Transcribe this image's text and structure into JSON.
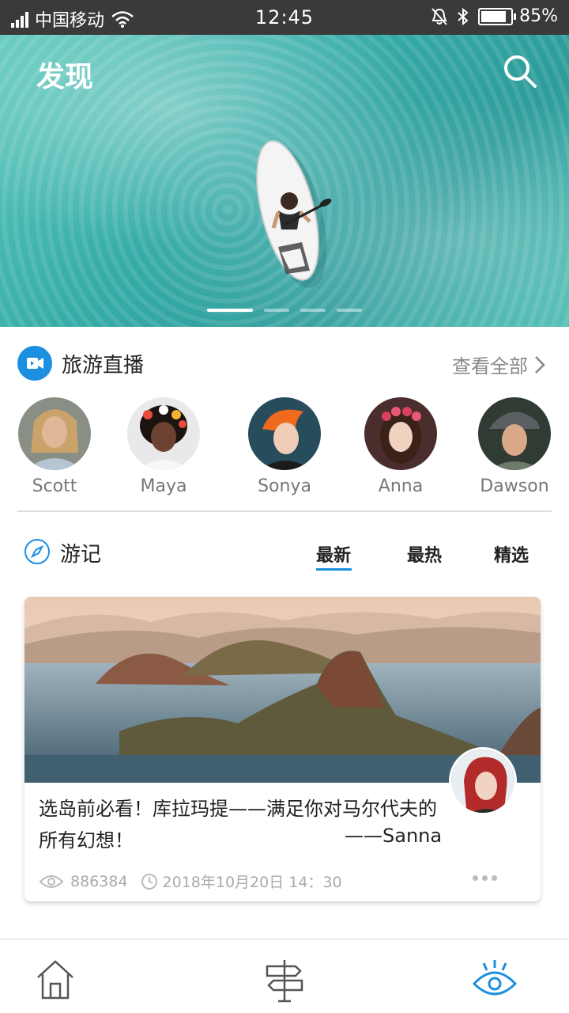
{
  "status": {
    "carrier": "中国移动",
    "time": "12:45",
    "battery_percent": "85%",
    "battery_level": 0.85
  },
  "hero": {
    "title": "发现",
    "slide_count": 4,
    "active_slide": 1
  },
  "live": {
    "title": "旅游直播",
    "view_all": "查看全部",
    "streamers": [
      {
        "name": "Scott"
      },
      {
        "name": "Maya"
      },
      {
        "name": "Sonya"
      },
      {
        "name": "Anna"
      },
      {
        "name": "Dawson"
      }
    ]
  },
  "travelogue": {
    "title": "游记",
    "tabs": [
      {
        "label": "最新",
        "active": true
      },
      {
        "label": "最热",
        "active": false
      },
      {
        "label": "精选",
        "active": false
      }
    ],
    "card": {
      "text": "选岛前必看！库拉玛提——满足你对马尔代夫的所有幻想！",
      "author": "——Sanna",
      "views": "886384",
      "date": "2018年10月20日 14：30"
    }
  },
  "nav": {
    "items": [
      {
        "icon": "home-icon",
        "active": false
      },
      {
        "icon": "signpost-icon",
        "active": false
      },
      {
        "icon": "eye-icon",
        "active": true
      }
    ]
  },
  "colors": {
    "accent": "#1b8fe0",
    "status_bar": "#3a3a3a"
  }
}
